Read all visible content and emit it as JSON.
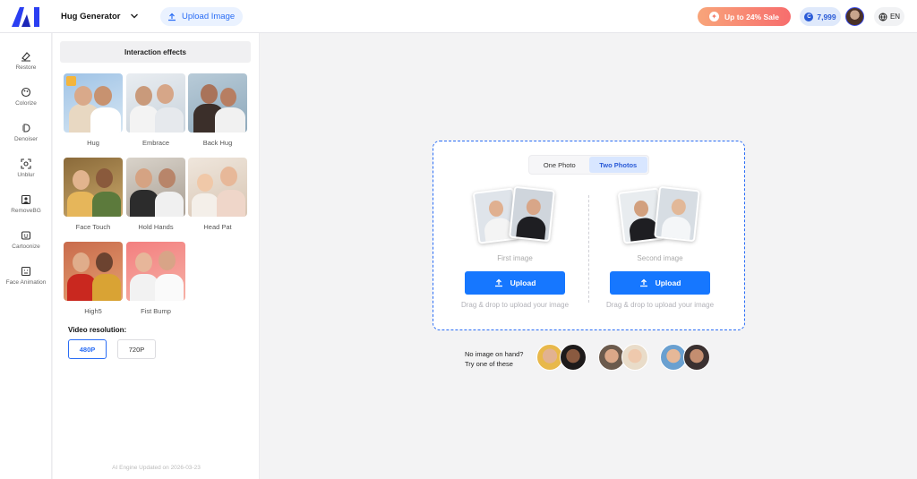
{
  "header": {
    "app_title": "Hug Generator",
    "upload_label": "Upload Image",
    "sale_label": "Up to 24% Sale",
    "credits": "7,999",
    "language": "EN"
  },
  "rail": [
    {
      "label": "Restore",
      "icon": "eraser-icon"
    },
    {
      "label": "Colorize",
      "icon": "palette-icon"
    },
    {
      "label": "Denoiser",
      "icon": "denoise-icon"
    },
    {
      "label": "Unblur",
      "icon": "focus-icon"
    },
    {
      "label": "RemoveBG",
      "icon": "portrait-icon"
    },
    {
      "label": "Cartoonize",
      "icon": "cartoon-icon"
    },
    {
      "label": "Face Animation",
      "icon": "face-frame-icon"
    }
  ],
  "panel": {
    "title": "Interaction effects",
    "effects": [
      {
        "label": "Hug"
      },
      {
        "label": "Embrace"
      },
      {
        "label": "Back Hug"
      },
      {
        "label": "Face Touch"
      },
      {
        "label": "Hold Hands"
      },
      {
        "label": "Head Pat"
      },
      {
        "label": "High5"
      },
      {
        "label": "Fist Bump"
      }
    ],
    "resolution_title": "Video resolution:",
    "resolutions": [
      "480P",
      "720P"
    ],
    "selected_resolution": "480P",
    "engine_note": "AI Engine Updated on 2026-03-23"
  },
  "main": {
    "tabs": [
      "One Photo",
      "Two Photos"
    ],
    "active_tab": "Two Photos",
    "slots": [
      {
        "caption": "First image",
        "button": "Upload",
        "hint": "Drag & drop to upload your image"
      },
      {
        "caption": "Second image",
        "button": "Upload",
        "hint": "Drag & drop to upload your image"
      }
    ],
    "sample_line1": "No image on hand?",
    "sample_line2": "Try one of these"
  },
  "colors": {
    "accent": "#1677ff",
    "sale_gradient_start": "#f8a57a",
    "sale_gradient_end": "#f76d6d"
  }
}
